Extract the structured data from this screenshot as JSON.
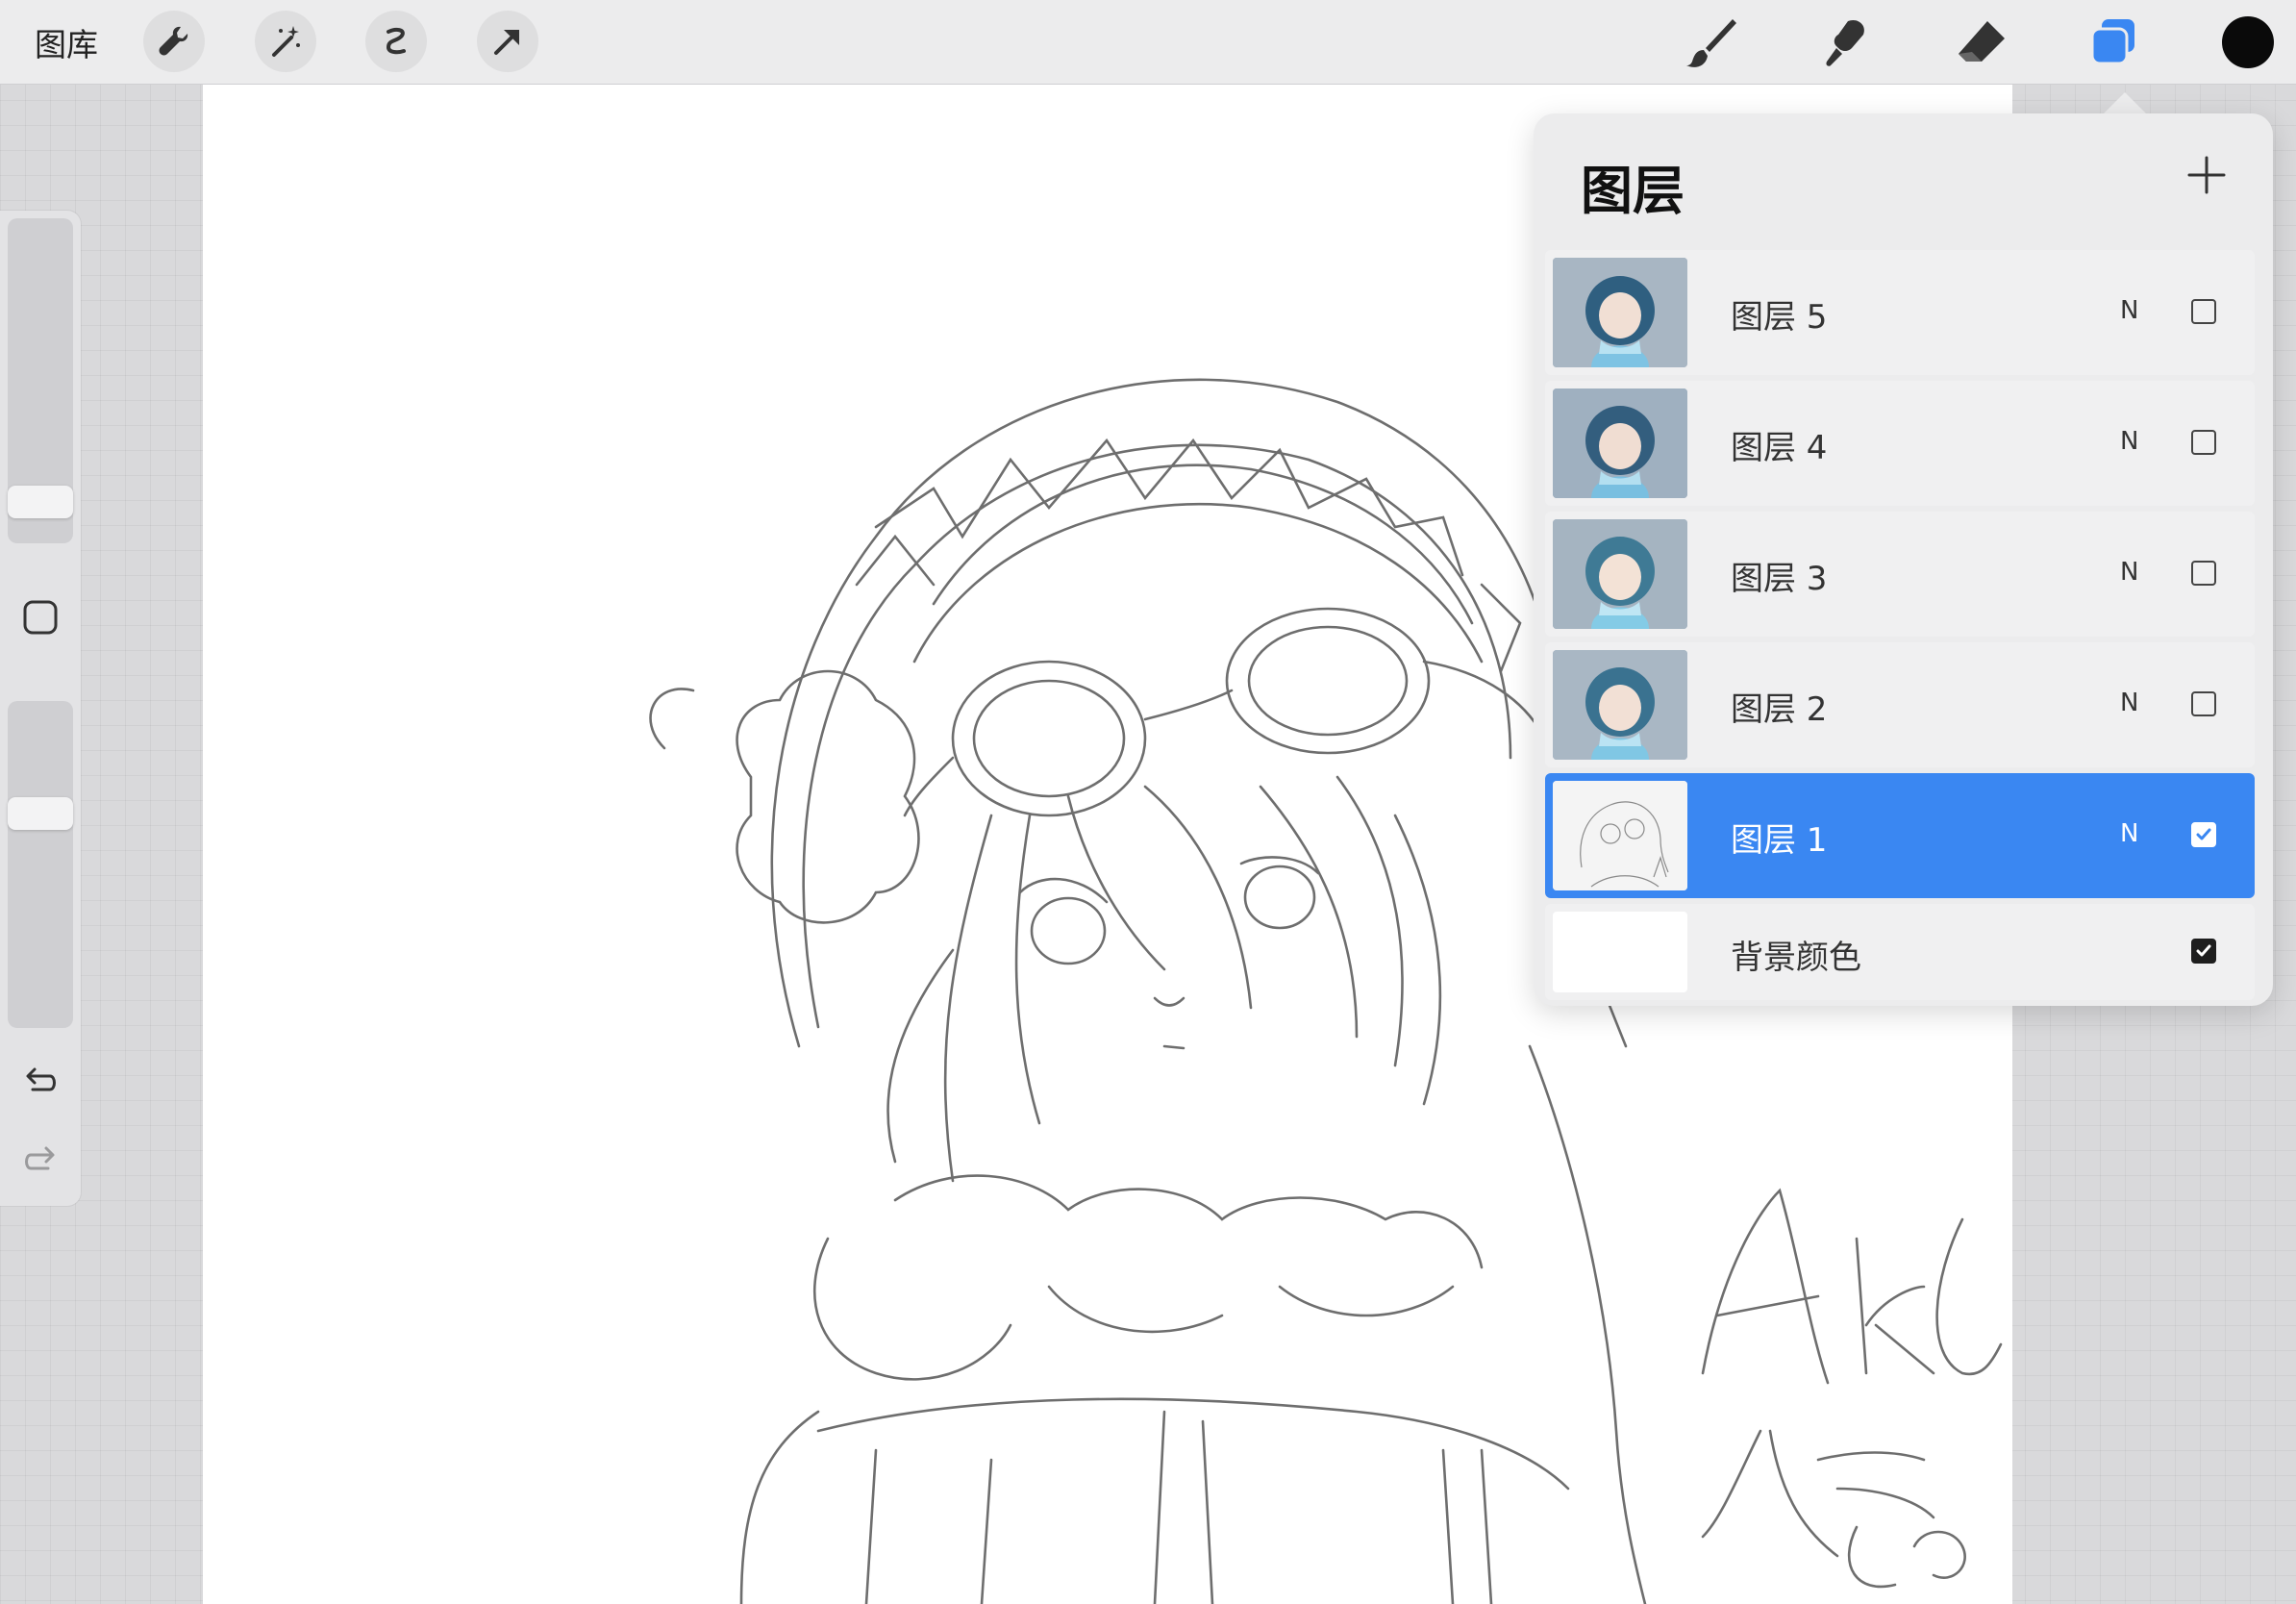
{
  "topbar": {
    "gallery_label": "图库",
    "left_tools": [
      "wrench-icon",
      "magic-wand-icon",
      "selection-icon",
      "transform-arrow-icon"
    ],
    "right_tools": [
      "brush-icon",
      "smudge-icon",
      "eraser-icon",
      "layers-icon"
    ],
    "accent_color": "#3a87f2",
    "current_color": "#0a0a0a"
  },
  "sidebar": {
    "brush_size": 0.15,
    "opacity": 0.67
  },
  "layers_panel": {
    "title": "图层",
    "layers": [
      {
        "name": "图层 5",
        "blend_mode": "N",
        "visible": false,
        "selected": false
      },
      {
        "name": "图层 4",
        "blend_mode": "N",
        "visible": false,
        "selected": false
      },
      {
        "name": "图层 3",
        "blend_mode": "N",
        "visible": false,
        "selected": false
      },
      {
        "name": "图层 2",
        "blend_mode": "N",
        "visible": false,
        "selected": false
      },
      {
        "name": "图层 1",
        "blend_mode": "N",
        "visible": true,
        "selected": true
      }
    ],
    "background": {
      "name": "背景颜色",
      "visible": true,
      "color": "#ffffff"
    }
  }
}
